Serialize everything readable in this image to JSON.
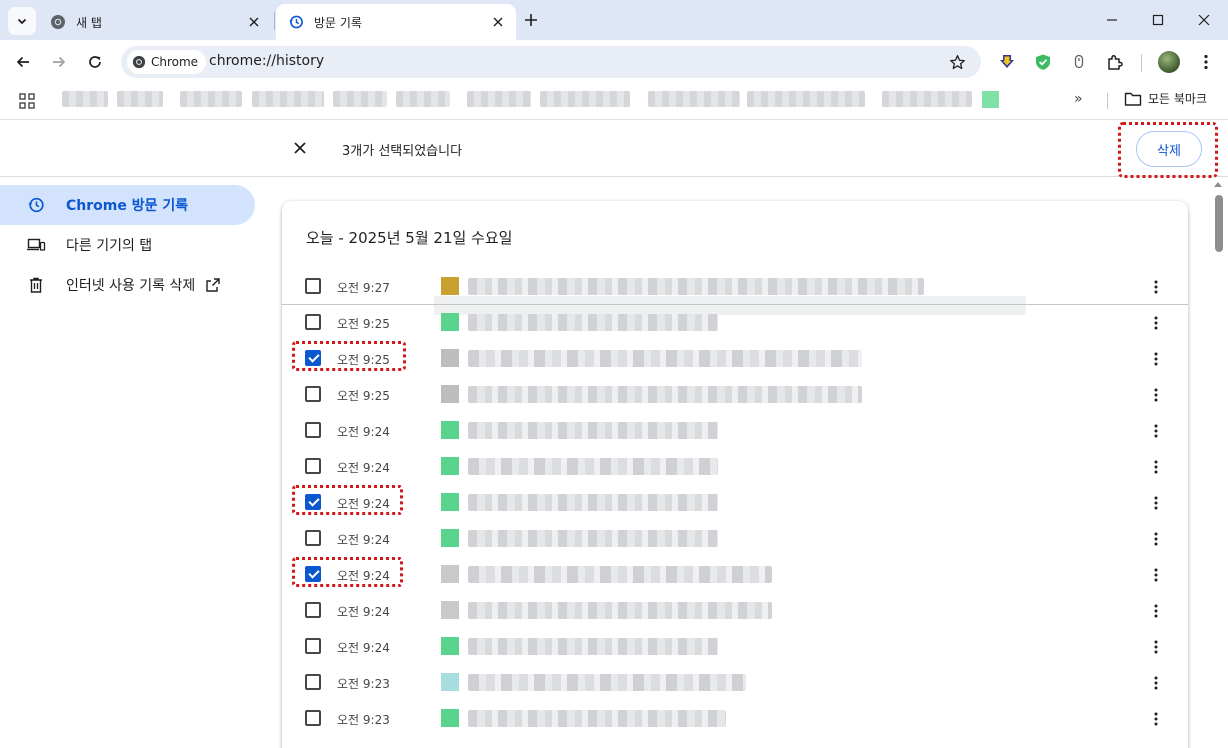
{
  "tabs": [
    {
      "title": "새 탭",
      "active": false
    },
    {
      "title": "방문 기록",
      "active": true
    }
  ],
  "toolbar": {
    "chip_label": "Chrome",
    "url": "chrome://history"
  },
  "bookmarks": {
    "all_bookmarks_label": "모든 북마크",
    "more_label": "»"
  },
  "selection": {
    "count_text": "3개가 선택되었습니다",
    "delete_label": "삭제"
  },
  "sidebar": {
    "items": [
      {
        "label": "Chrome 방문 기록",
        "icon": "history-icon",
        "active": true
      },
      {
        "label": "다른 기기의 탭",
        "icon": "devices-icon",
        "active": false
      },
      {
        "label": "인터넷 사용 기록 삭제",
        "icon": "trash-icon",
        "active": false,
        "external": true
      }
    ]
  },
  "history": {
    "date_heading": "오늘 - 2025년 5월 21일 수요일",
    "rows": [
      {
        "time": "오전 9:27",
        "checked": false,
        "favicon_color": "#c8a030"
      },
      {
        "time": "오전 9:25",
        "checked": false,
        "favicon_color": "#5ad48c"
      },
      {
        "time": "오전 9:25",
        "checked": true,
        "favicon_color": "#bdbdbd"
      },
      {
        "time": "오전 9:25",
        "checked": false,
        "favicon_color": "#bdbdbd"
      },
      {
        "time": "오전 9:24",
        "checked": false,
        "favicon_color": "#5ad48c"
      },
      {
        "time": "오전 9:24",
        "checked": false,
        "favicon_color": "#5ad48c"
      },
      {
        "time": "오전 9:24",
        "checked": true,
        "favicon_color": "#5ad48c"
      },
      {
        "time": "오전 9:24",
        "checked": false,
        "favicon_color": "#5ad48c"
      },
      {
        "time": "오전 9:24",
        "checked": true,
        "favicon_color": "#c9c9c9"
      },
      {
        "time": "오전 9:24",
        "checked": false,
        "favicon_color": "#c9c9c9"
      },
      {
        "time": "오전 9:24",
        "checked": false,
        "favicon_color": "#5ad48c"
      },
      {
        "time": "오전 9:23",
        "checked": false,
        "favicon_color": "#a8dde0"
      },
      {
        "time": "오전 9:23",
        "checked": false,
        "favicon_color": "#5ad48c"
      }
    ]
  },
  "colors": {
    "accent": "#0b57d0",
    "highlight_annotation": "#d11919",
    "tabstrip_bg": "#dfe7f7"
  }
}
